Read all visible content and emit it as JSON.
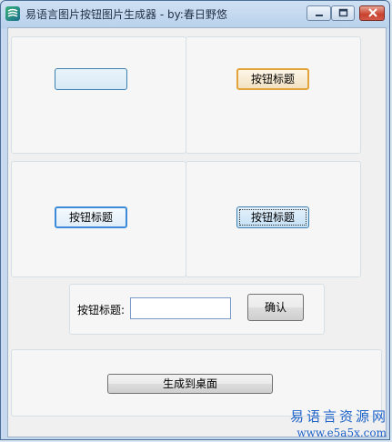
{
  "window": {
    "title": "易语言图片按钮图片生成器 - by:春日野悠"
  },
  "previews": {
    "button_1_label": "",
    "button_2_label": "按钮标题",
    "button_3_label": "按钮标题",
    "button_4_label": "按钮标题"
  },
  "form": {
    "caption_label": "按钮标题:",
    "caption_value": "",
    "confirm_label": "确认"
  },
  "actions": {
    "generate_label": "生成到桌面"
  },
  "watermark": {
    "brand": "易语言资源网",
    "url": "www.e5a5x.com"
  },
  "colors": {
    "hover_border": "#e2a33b",
    "focus_border": "#3c8ad8",
    "watermark": "#1d62c9"
  }
}
